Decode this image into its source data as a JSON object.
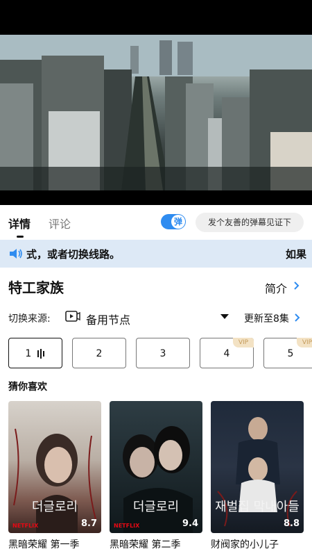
{
  "tabs": {
    "details": "详情",
    "comments": "评论"
  },
  "danmu": {
    "toggle": "弹",
    "placeholder": "发个友善的弹幕见证下"
  },
  "notice": {
    "text": "式，或者切换线路。",
    "text_tail": "如果"
  },
  "show": {
    "title": "特工家族",
    "intro_label": "简介"
  },
  "source": {
    "label": "切换来源:",
    "value": "备用节点",
    "update": "更新至8集"
  },
  "episodes": [
    {
      "num": "1",
      "vip": ""
    },
    {
      "num": "2",
      "vip": ""
    },
    {
      "num": "3",
      "vip": ""
    },
    {
      "num": "4",
      "vip": "VIP"
    },
    {
      "num": "5",
      "vip": "VIP"
    }
  ],
  "recommend": {
    "title": "猜你喜欢",
    "items": [
      {
        "title": "黑暗荣耀 第一季",
        "rating": "8.7",
        "poster_text": "더글로리",
        "brand": "NETFLIX"
      },
      {
        "title": "黑暗荣耀 第二季",
        "rating": "9.4",
        "poster_text": "더글로리",
        "brand": "NETFLIX"
      },
      {
        "title": "财阀家的小儿子",
        "rating": "8.8",
        "poster_text": "재벌집 막내아들",
        "brand": ""
      }
    ]
  },
  "colors": {
    "accent": "#2f8cf0",
    "notice_bg": "#dde9f6",
    "vip_bg": "#f3e2c4",
    "vip_text": "#c49b5b"
  },
  "icons": {
    "speaker": "speaker-icon",
    "source": "video-source-icon",
    "chevron": "chevron-right-icon"
  }
}
